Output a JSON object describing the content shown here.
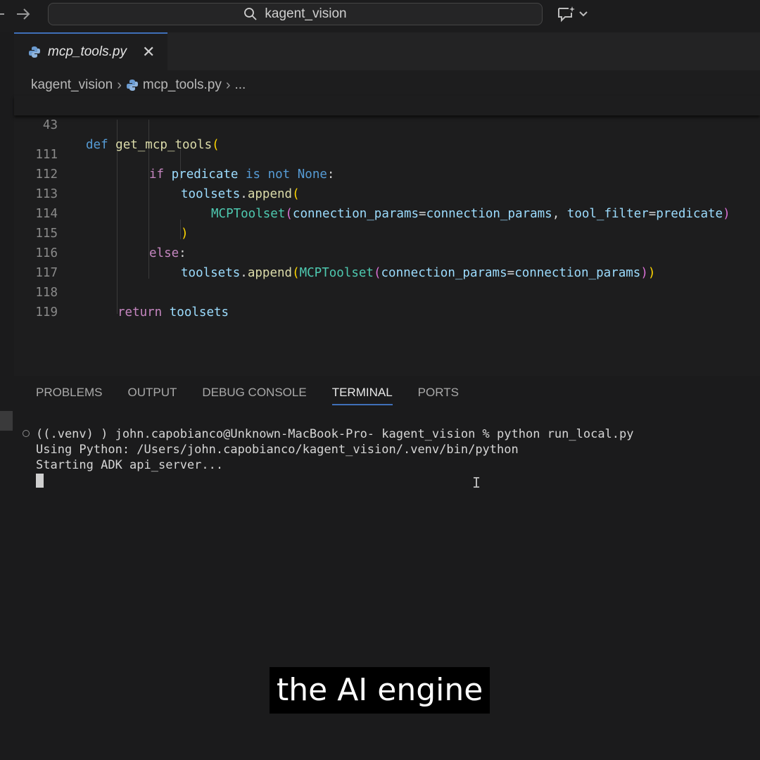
{
  "titlebar": {
    "search_label": "kagent_vision"
  },
  "editor": {
    "tab": {
      "label": "mcp_tools.py",
      "close_symbol": "✕"
    },
    "breadcrumb": {
      "folder": "kagent_vision",
      "file": "mcp_tools.py",
      "more": "..."
    },
    "sticky_line": {
      "number": "43",
      "keyword": "def",
      "name": "get_mcp_tools",
      "paren": "("
    },
    "lines": [
      {
        "number": "111"
      },
      {
        "number": "112"
      },
      {
        "number": "113"
      },
      {
        "number": "114"
      },
      {
        "number": "115"
      },
      {
        "number": "116"
      },
      {
        "number": "117"
      },
      {
        "number": "118"
      },
      {
        "number": "119"
      }
    ]
  },
  "panel": {
    "tabs": [
      "PROBLEMS",
      "OUTPUT",
      "DEBUG CONSOLE",
      "TERMINAL",
      "PORTS"
    ],
    "active_tab": "TERMINAL",
    "terminal_lines": [
      "((.venv) ) john.capobianco@Unknown-MacBook-Pro- kagent_vision % python run_local.py",
      "Using Python: /Users/john.capobianco/kagent_vision/.venv/bin/python",
      "Starting ADK api_server..."
    ]
  },
  "subtitle": "the AI engine",
  "colors": {
    "accent": "#3f6fb8",
    "background": "#1b1b1c"
  }
}
